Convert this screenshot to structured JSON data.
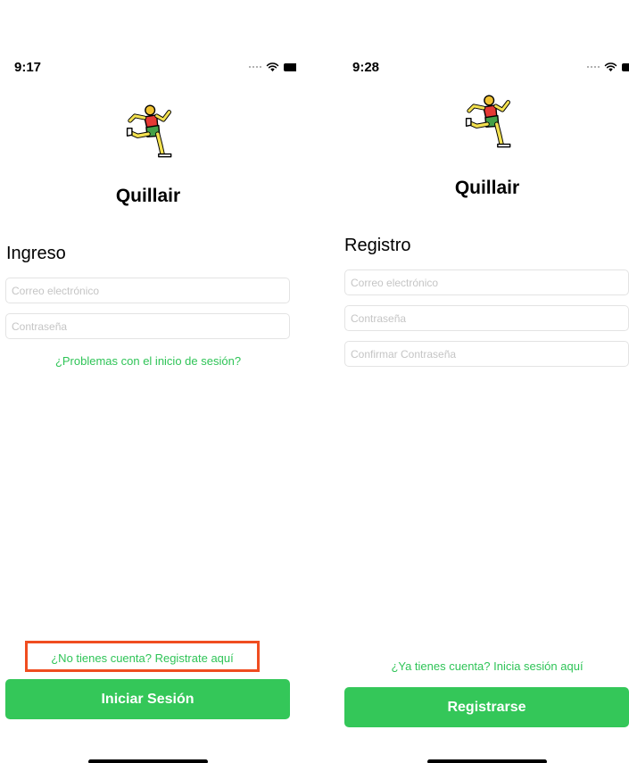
{
  "left_screen": {
    "status_time": "9:17",
    "app_name": "Quillair",
    "section_title": "Ingreso",
    "email_placeholder": "Correo electrónico",
    "password_placeholder": "Contraseña",
    "trouble_link": "¿Problemas con el inicio de sesión?",
    "register_link": "¿No tienes cuenta? Registrate aquí",
    "login_button": "Iniciar Sesión"
  },
  "right_screen": {
    "status_time": "9:28",
    "app_name": "Quillair",
    "section_title": "Registro",
    "email_placeholder": "Correo electrónico",
    "password_placeholder": "Contraseña",
    "confirm_password_placeholder": "Confirmar Contraseña",
    "login_link": "¿Ya tienes cuenta? Inicia sesión aquí",
    "register_button": "Registrarse"
  },
  "icons": {
    "logo": "running-man-icon",
    "wifi": "wifi-icon",
    "battery": "battery-icon",
    "signal": "signal-icon"
  },
  "colors": {
    "accent_green": "#34c759",
    "link_green": "#2fc457",
    "highlight": "#f04d20",
    "input_border": "#e3e3e3",
    "placeholder": "#c5c5c5"
  }
}
